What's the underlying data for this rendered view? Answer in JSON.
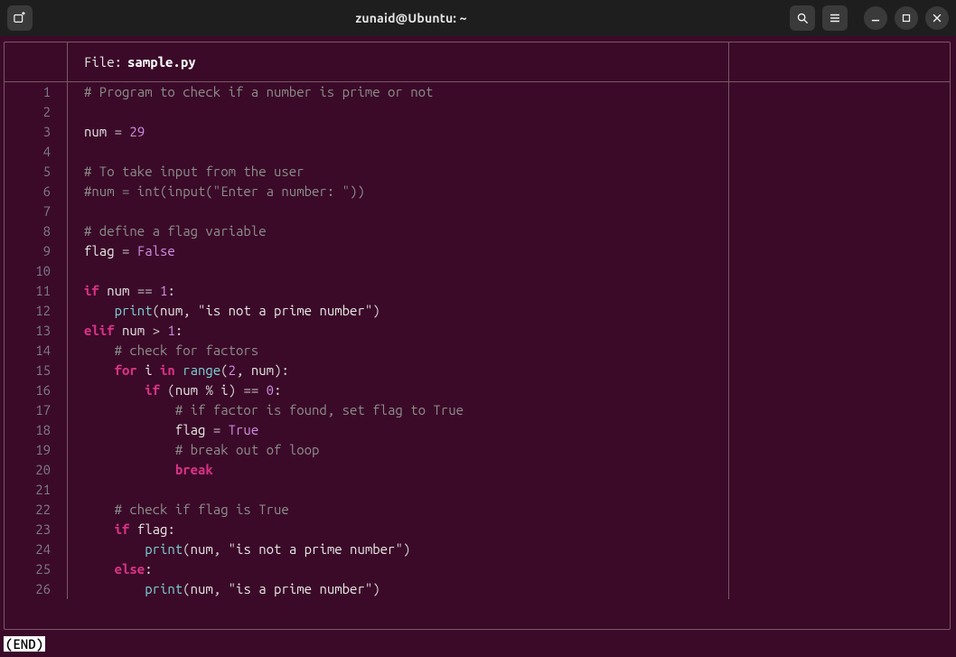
{
  "window": {
    "title": "zunaid@Ubuntu: ~"
  },
  "titlebar_icons": {
    "new_tab": "new-tab-icon",
    "search": "search-icon",
    "menu": "hamburger-icon",
    "minimize": "minimize-icon",
    "maximize": "maximize-icon",
    "close": "close-icon"
  },
  "file_header": {
    "label": "File:",
    "filename": "sample.py"
  },
  "pager_status": "(END)",
  "code_lines": [
    {
      "n": 1,
      "tokens": [
        [
          "cm",
          "# Program to check if a number is prime or not"
        ]
      ]
    },
    {
      "n": 2,
      "tokens": []
    },
    {
      "n": 3,
      "tokens": [
        [
          "id",
          "num "
        ],
        [
          "op",
          "= "
        ],
        [
          "num",
          "29"
        ]
      ]
    },
    {
      "n": 4,
      "tokens": []
    },
    {
      "n": 5,
      "tokens": [
        [
          "cm",
          "# To take input from the user"
        ]
      ]
    },
    {
      "n": 6,
      "tokens": [
        [
          "cm",
          "#num = int(input(\"Enter a number: \"))"
        ]
      ]
    },
    {
      "n": 7,
      "tokens": []
    },
    {
      "n": 8,
      "tokens": [
        [
          "cm",
          "# define a flag variable"
        ]
      ]
    },
    {
      "n": 9,
      "tokens": [
        [
          "id",
          "flag "
        ],
        [
          "op",
          "= "
        ],
        [
          "kc",
          "False"
        ]
      ]
    },
    {
      "n": 10,
      "tokens": []
    },
    {
      "n": 11,
      "tokens": [
        [
          "kw",
          "if"
        ],
        [
          "id",
          " num "
        ],
        [
          "op",
          "== "
        ],
        [
          "num",
          "1"
        ],
        [
          "op",
          ":"
        ]
      ]
    },
    {
      "n": 12,
      "tokens": [
        [
          "id",
          "    "
        ],
        [
          "fn",
          "print"
        ],
        [
          "op",
          "("
        ],
        [
          "id",
          "num"
        ],
        [
          "op",
          ", "
        ],
        [
          "str",
          "\"is not a prime number\""
        ],
        [
          "op",
          ")"
        ]
      ]
    },
    {
      "n": 13,
      "tokens": [
        [
          "kw",
          "elif"
        ],
        [
          "id",
          " num "
        ],
        [
          "op",
          "> "
        ],
        [
          "num",
          "1"
        ],
        [
          "op",
          ":"
        ]
      ]
    },
    {
      "n": 14,
      "tokens": [
        [
          "id",
          "    "
        ],
        [
          "cm",
          "# check for factors"
        ]
      ]
    },
    {
      "n": 15,
      "tokens": [
        [
          "id",
          "    "
        ],
        [
          "kw",
          "for"
        ],
        [
          "id",
          " i "
        ],
        [
          "kw",
          "in"
        ],
        [
          "id",
          " "
        ],
        [
          "fn",
          "range"
        ],
        [
          "op",
          "("
        ],
        [
          "num",
          "2"
        ],
        [
          "op",
          ", "
        ],
        [
          "id",
          "num"
        ],
        [
          "op",
          "):"
        ]
      ]
    },
    {
      "n": 16,
      "tokens": [
        [
          "id",
          "        "
        ],
        [
          "kw",
          "if"
        ],
        [
          "id",
          " "
        ],
        [
          "op",
          "("
        ],
        [
          "id",
          "num "
        ],
        [
          "op",
          "% "
        ],
        [
          "id",
          "i"
        ],
        [
          "op",
          ") == "
        ],
        [
          "num",
          "0"
        ],
        [
          "op",
          ":"
        ]
      ]
    },
    {
      "n": 17,
      "tokens": [
        [
          "id",
          "            "
        ],
        [
          "cm",
          "# if factor is found, set flag to True"
        ]
      ]
    },
    {
      "n": 18,
      "tokens": [
        [
          "id",
          "            flag "
        ],
        [
          "op",
          "= "
        ],
        [
          "kc",
          "True"
        ]
      ]
    },
    {
      "n": 19,
      "tokens": [
        [
          "id",
          "            "
        ],
        [
          "cm",
          "# break out of loop"
        ]
      ]
    },
    {
      "n": 20,
      "tokens": [
        [
          "id",
          "            "
        ],
        [
          "kw",
          "break"
        ]
      ]
    },
    {
      "n": 21,
      "tokens": []
    },
    {
      "n": 22,
      "tokens": [
        [
          "id",
          "    "
        ],
        [
          "cm",
          "# check if flag is True"
        ]
      ]
    },
    {
      "n": 23,
      "tokens": [
        [
          "id",
          "    "
        ],
        [
          "kw",
          "if"
        ],
        [
          "id",
          " flag"
        ],
        [
          "op",
          ":"
        ]
      ]
    },
    {
      "n": 24,
      "tokens": [
        [
          "id",
          "        "
        ],
        [
          "fn",
          "print"
        ],
        [
          "op",
          "("
        ],
        [
          "id",
          "num"
        ],
        [
          "op",
          ", "
        ],
        [
          "str",
          "\"is not a prime number\""
        ],
        [
          "op",
          ")"
        ]
      ]
    },
    {
      "n": 25,
      "tokens": [
        [
          "id",
          "    "
        ],
        [
          "kw",
          "else"
        ],
        [
          "op",
          ":"
        ]
      ]
    },
    {
      "n": 26,
      "tokens": [
        [
          "id",
          "        "
        ],
        [
          "fn",
          "print"
        ],
        [
          "op",
          "("
        ],
        [
          "id",
          "num"
        ],
        [
          "op",
          ", "
        ],
        [
          "str",
          "\"is a prime number\""
        ],
        [
          "op",
          ")"
        ]
      ]
    }
  ]
}
